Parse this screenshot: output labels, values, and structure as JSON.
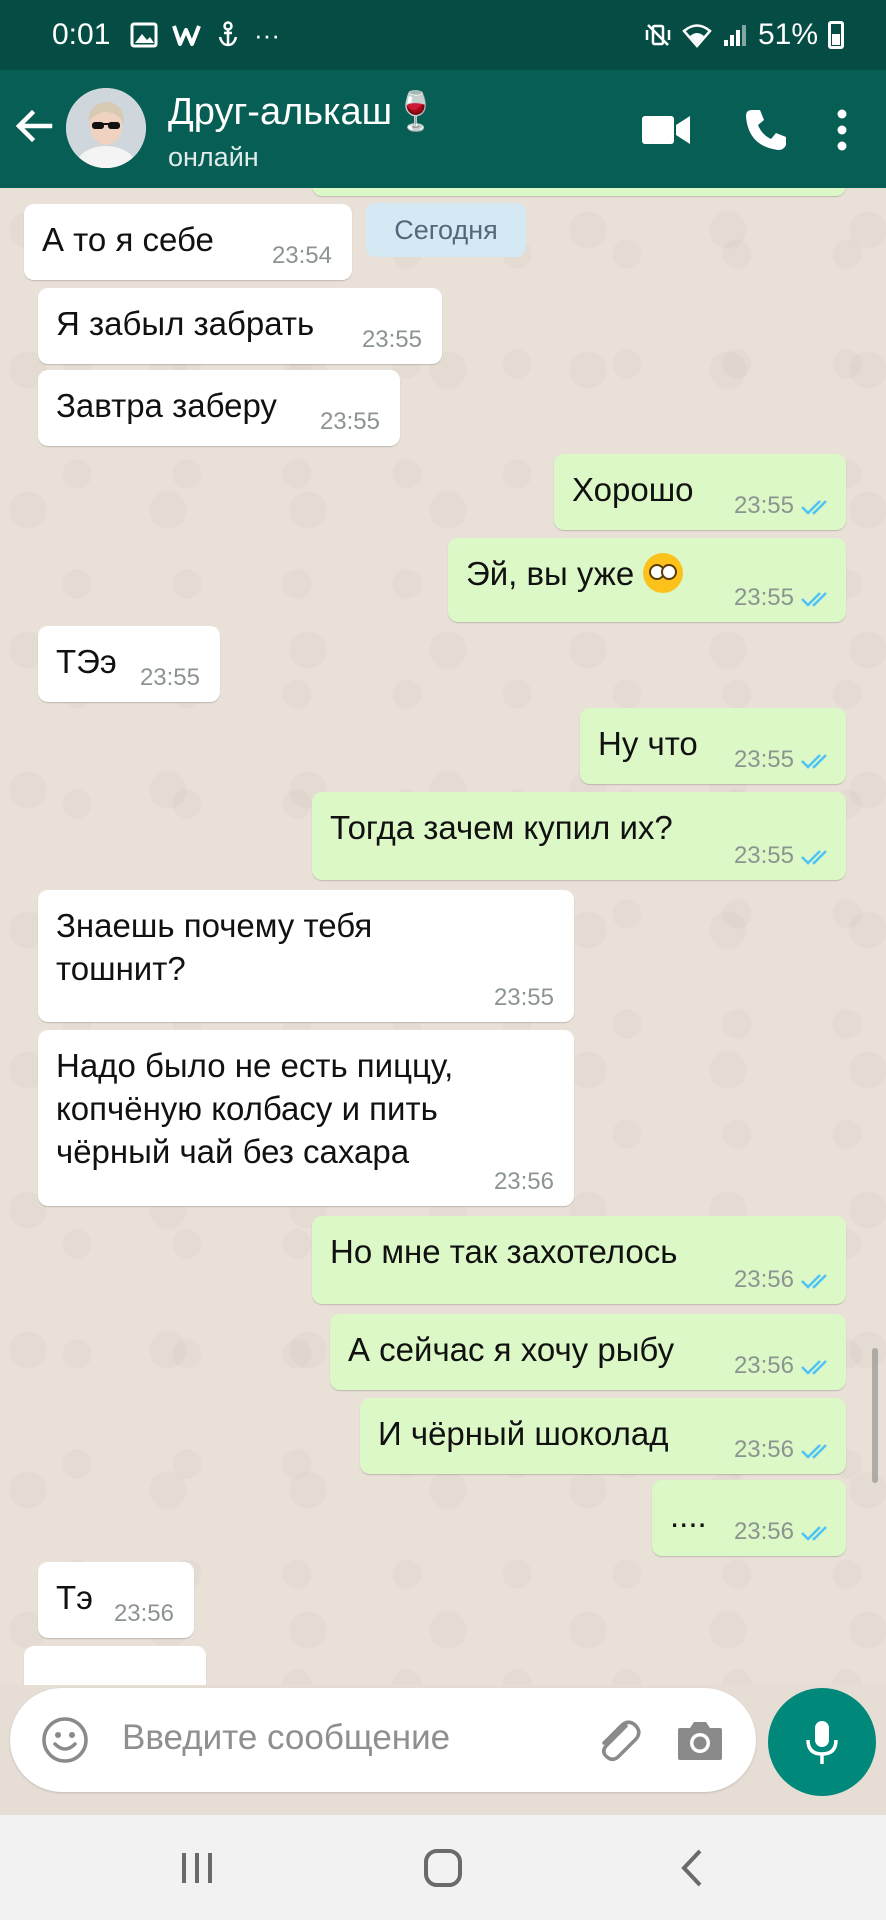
{
  "status_bar": {
    "time": "0:01",
    "battery": "51%",
    "more": "···"
  },
  "header": {
    "contact_name": "Друг-алькаш🍷",
    "status": "онлайн"
  },
  "date_chip": "Сегодня",
  "messages": [
    {
      "dir": "in",
      "text": "А то я себе",
      "time": "23:54"
    },
    {
      "dir": "in",
      "text": "Я забыл забрать",
      "time": "23:55"
    },
    {
      "dir": "in",
      "text": "Завтра заберу",
      "time": "23:55"
    },
    {
      "dir": "out",
      "text": "Хорошо",
      "time": "23:55",
      "read": true
    },
    {
      "dir": "out",
      "text": "Эй, вы уже",
      "time": "23:55",
      "read": true,
      "emoji": "face-with-rolling-eyes"
    },
    {
      "dir": "in",
      "text": "ТЭэ",
      "time": "23:55"
    },
    {
      "dir": "out",
      "text": "Ну что",
      "time": "23:55",
      "read": true
    },
    {
      "dir": "out",
      "text": "Тогда зачем купил их?",
      "time": "23:55",
      "read": true
    },
    {
      "dir": "in",
      "text": "Знаешь почему тебя тошнит?",
      "time": "23:55"
    },
    {
      "dir": "in",
      "text": "Надо было не есть пиццу, копчёную колбасу и пить чёрный чай без сахара",
      "time": "23:56"
    },
    {
      "dir": "out",
      "text": "Но мне так захотелось",
      "time": "23:56",
      "read": true
    },
    {
      "dir": "out",
      "text": "А сейчас я хочу рыбу",
      "time": "23:56",
      "read": true
    },
    {
      "dir": "out",
      "text": "И чёрный шоколад",
      "time": "23:56",
      "read": true
    },
    {
      "dir": "out",
      "text": "....",
      "time": "23:56",
      "read": true
    },
    {
      "dir": "in",
      "text": "Тэ",
      "time": "23:56"
    }
  ],
  "input": {
    "placeholder": "Введите сообщение"
  },
  "colors": {
    "header": "#075e54",
    "status_bar": "#054d44",
    "outgoing_bubble": "#dcf8c6",
    "incoming_bubble": "#ffffff",
    "read_ticks": "#4fc3f7",
    "mic_button": "#00897b"
  },
  "icons": [
    "back-arrow-icon",
    "video-call-icon",
    "phone-icon",
    "more-vert-icon",
    "emoji-icon",
    "attach-icon",
    "camera-icon",
    "mic-icon",
    "nav-recents-icon",
    "nav-home-icon",
    "nav-back-icon"
  ]
}
